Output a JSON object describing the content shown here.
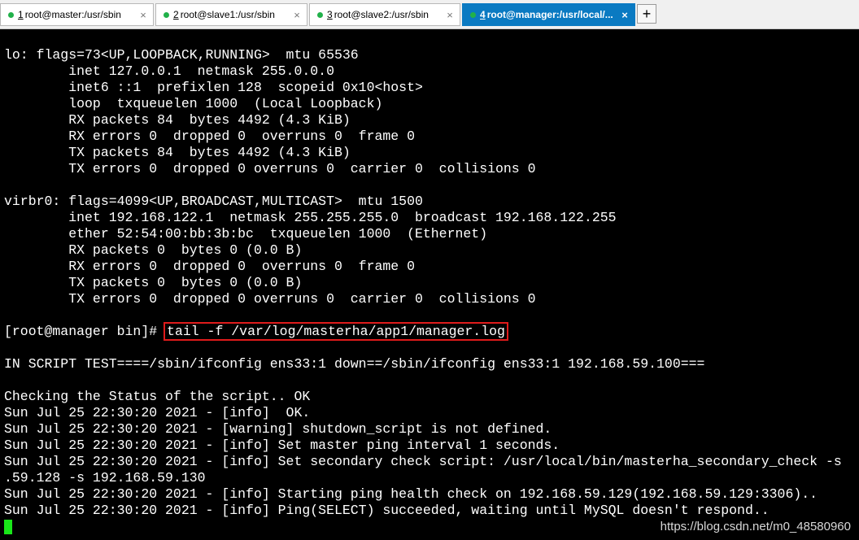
{
  "tabs": [
    {
      "number": "1",
      "label": " root@master:/usr/sbin"
    },
    {
      "number": "2",
      "label": " root@slave1:/usr/sbin"
    },
    {
      "number": "3",
      "label": " root@slave2:/usr/sbin"
    },
    {
      "number": "4",
      "label": " root@manager:/usr/local/..."
    }
  ],
  "tab_close_glyph": "×",
  "add_tab_glyph": "+",
  "terminal": {
    "lines": [
      "lo: flags=73<UP,LOOPBACK,RUNNING>  mtu 65536",
      "        inet 127.0.0.1  netmask 255.0.0.0",
      "        inet6 ::1  prefixlen 128  scopeid 0x10<host>",
      "        loop  txqueuelen 1000  (Local Loopback)",
      "        RX packets 84  bytes 4492 (4.3 KiB)",
      "        RX errors 0  dropped 0  overruns 0  frame 0",
      "        TX packets 84  bytes 4492 (4.3 KiB)",
      "        TX errors 0  dropped 0 overruns 0  carrier 0  collisions 0",
      "",
      "virbr0: flags=4099<UP,BROADCAST,MULTICAST>  mtu 1500",
      "        inet 192.168.122.1  netmask 255.255.255.0  broadcast 192.168.122.255",
      "        ether 52:54:00:bb:3b:bc  txqueuelen 1000  (Ethernet)",
      "        RX packets 0  bytes 0 (0.0 B)",
      "        RX errors 0  dropped 0  overruns 0  frame 0",
      "        TX packets 0  bytes 0 (0.0 B)",
      "        TX errors 0  dropped 0 overruns 0  carrier 0  collisions 0"
    ],
    "prompt": "[root@manager bin]# ",
    "command": "tail -f /var/log/masterha/app1/manager.log",
    "output_lines": [
      "IN SCRIPT TEST====/sbin/ifconfig ens33:1 down==/sbin/ifconfig ens33:1 192.168.59.100===",
      "",
      "Checking the Status of the script.. OK",
      "Sun Jul 25 22:30:20 2021 - [info]  OK.",
      "Sun Jul 25 22:30:20 2021 - [warning] shutdown_script is not defined.",
      "Sun Jul 25 22:30:20 2021 - [info] Set master ping interval 1 seconds.",
      "Sun Jul 25 22:30:20 2021 - [info] Set secondary check script: /usr/local/bin/masterha_secondary_check -s",
      ".59.128 -s 192.168.59.130",
      "Sun Jul 25 22:30:20 2021 - [info] Starting ping health check on 192.168.59.129(192.168.59.129:3306)..",
      "Sun Jul 25 22:30:20 2021 - [info] Ping(SELECT) succeeded, waiting until MySQL doesn't respond.."
    ]
  },
  "watermark": "https://blog.csdn.net/m0_48580960",
  "colors": {
    "terminal_bg": "#000000",
    "terminal_fg": "#ffffff",
    "active_tab": "#0a7ac2",
    "status_dot": "#21b14a",
    "highlight_box": "#e01b1b",
    "cursor": "#19e619"
  }
}
